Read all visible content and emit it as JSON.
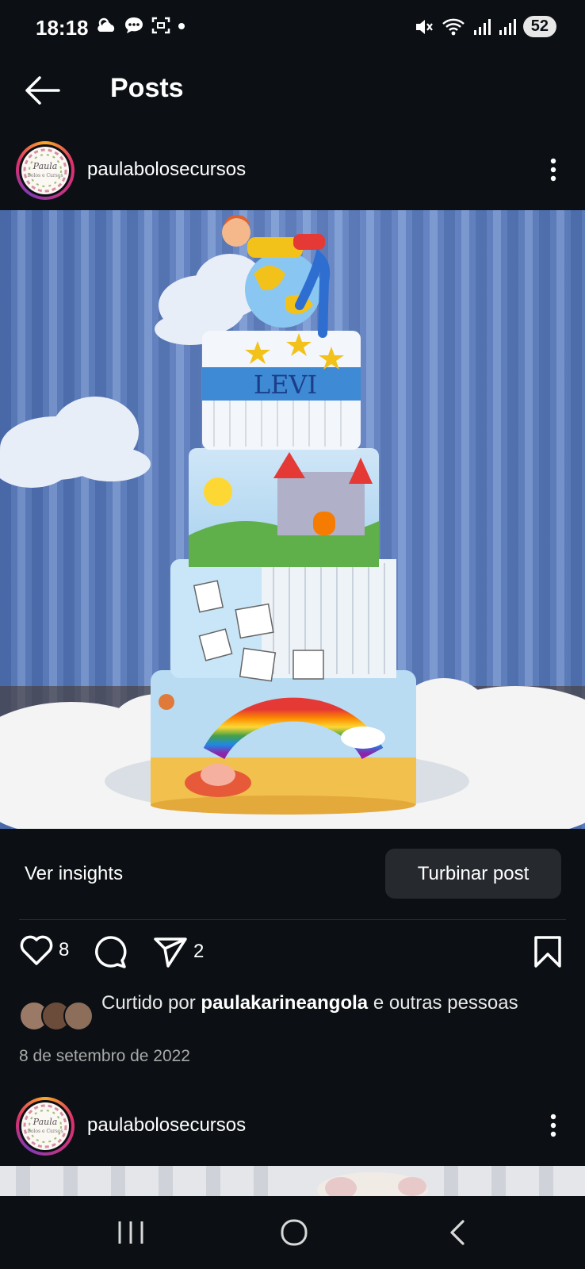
{
  "status": {
    "time": "18:18",
    "battery": "52"
  },
  "header": {
    "title": "Posts"
  },
  "post": {
    "username": "paulabolosecursos",
    "insights_label": "Ver insights",
    "boost_label": "Turbinar post",
    "likes_count": "8",
    "shares_count": "2",
    "liked_prefix": "Curtido por",
    "liked_user": "paulakarineangola",
    "liked_suffix": "e outras pessoas",
    "date": "8 de setembro de 2022",
    "cake_name": "LEVI"
  },
  "next_post": {
    "username": "paulabolosecursos"
  },
  "icons": {
    "back": "arrow-left-icon",
    "more": "more-vertical-icon",
    "like": "heart-icon",
    "comment": "comment-icon",
    "share": "send-icon",
    "save": "bookmark-icon"
  }
}
